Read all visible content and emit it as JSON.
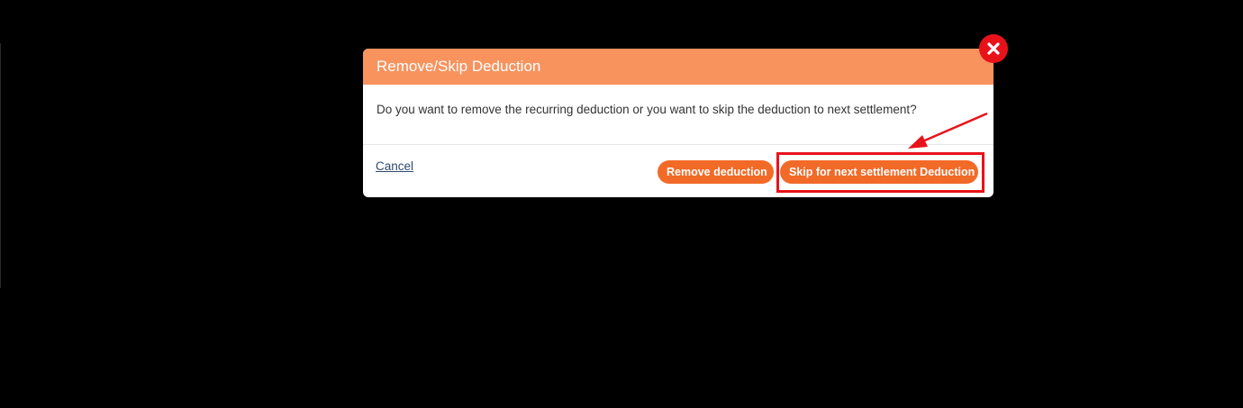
{
  "modal": {
    "title": "Remove/Skip Deduction",
    "message": "Do you want to remove the recurring deduction or you want to skip the deduction to next settlement?",
    "cancel_label": "Cancel",
    "remove_label": "Remove deduction",
    "skip_label": "Skip for next settlement Deduction"
  },
  "icons": {
    "close": "close-icon"
  },
  "colors": {
    "header": "#f8935e",
    "button": "#f26a28",
    "annotation": "#e8121b",
    "backdrop": "#000000"
  }
}
